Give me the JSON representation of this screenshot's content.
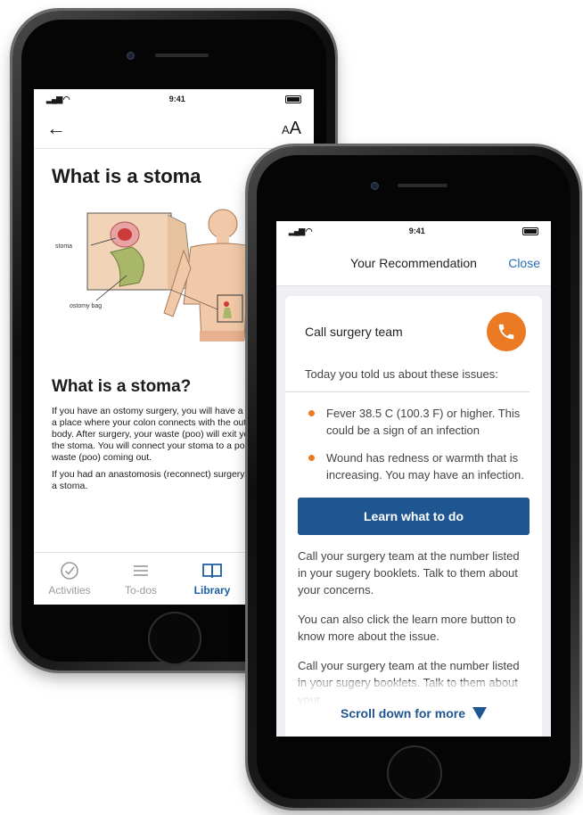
{
  "phone1": {
    "status": {
      "time": "9:41"
    },
    "nav": {
      "back_icon": "arrow-left-icon",
      "text_size_small": "A",
      "text_size_large": "A"
    },
    "article": {
      "title": "What is a stoma",
      "illustration": {
        "label_stoma": "stoma",
        "label_bag": "ostomy bag"
      },
      "subtitle": "What is a stoma?",
      "paragraph1": "If you have an ostomy surgery, you will have a stoma. A stoma is a place where your colon connects with the outside of your body. After surgery, your waste (poo) will exit your body through the stoma. You will connect your stoma to a pouch to collect the waste (poo) coming out.",
      "paragraph2": "If you had an anastomosis (reconnect) surgery, you will not have a stoma."
    },
    "tabs": [
      {
        "label": "Activities",
        "icon": "check-circle-icon",
        "active": false
      },
      {
        "label": "To-dos",
        "icon": "list-icon",
        "active": false
      },
      {
        "label": "Library",
        "icon": "book-icon",
        "active": true
      }
    ]
  },
  "phone2": {
    "status": {
      "time": "9:41"
    },
    "nav": {
      "title": "Your Recommendation",
      "close": "Close"
    },
    "card": {
      "title": "Call surgery team",
      "call_icon": "phone-icon",
      "intro": "Today you told us about these issues:",
      "issues": [
        "Fever 38.5 C (100.3 F) or higher. This could be a sign of an infection",
        "Wound has redness or warmth that is increasing. You may have an infection."
      ],
      "button": "Learn what to do",
      "paragraph1": "Call your surgery team at the number listed in your sugery booklets. Talk to them about your concerns.",
      "paragraph2": "You can also click the learn more button to know more about the issue.",
      "paragraph3": "Call your surgery team at the number listed in your sugery booklets. Talk to them about your"
    },
    "scroll_hint": "Scroll down for more"
  },
  "colors": {
    "accent_blue": "#1f5590",
    "link_blue": "#2a6db7",
    "alert_orange": "#ea7a24",
    "tab_active": "#1d5fa3"
  }
}
